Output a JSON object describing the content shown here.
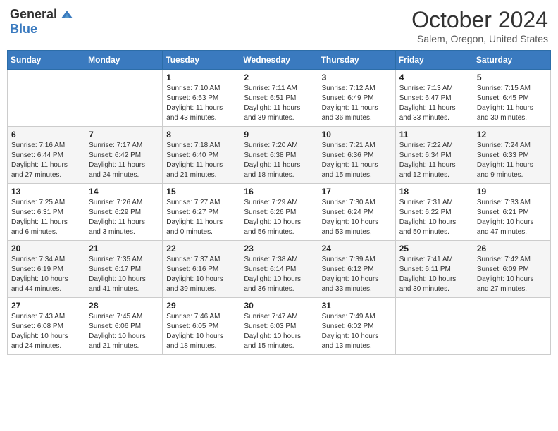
{
  "logo": {
    "general": "General",
    "blue": "Blue"
  },
  "title": "October 2024",
  "location": "Salem, Oregon, United States",
  "days_header": [
    "Sunday",
    "Monday",
    "Tuesday",
    "Wednesday",
    "Thursday",
    "Friday",
    "Saturday"
  ],
  "weeks": [
    [
      {
        "day": "",
        "sunrise": "",
        "sunset": "",
        "daylight": ""
      },
      {
        "day": "",
        "sunrise": "",
        "sunset": "",
        "daylight": ""
      },
      {
        "day": "1",
        "sunrise": "Sunrise: 7:10 AM",
        "sunset": "Sunset: 6:53 PM",
        "daylight": "Daylight: 11 hours and 43 minutes."
      },
      {
        "day": "2",
        "sunrise": "Sunrise: 7:11 AM",
        "sunset": "Sunset: 6:51 PM",
        "daylight": "Daylight: 11 hours and 39 minutes."
      },
      {
        "day": "3",
        "sunrise": "Sunrise: 7:12 AM",
        "sunset": "Sunset: 6:49 PM",
        "daylight": "Daylight: 11 hours and 36 minutes."
      },
      {
        "day": "4",
        "sunrise": "Sunrise: 7:13 AM",
        "sunset": "Sunset: 6:47 PM",
        "daylight": "Daylight: 11 hours and 33 minutes."
      },
      {
        "day": "5",
        "sunrise": "Sunrise: 7:15 AM",
        "sunset": "Sunset: 6:45 PM",
        "daylight": "Daylight: 11 hours and 30 minutes."
      }
    ],
    [
      {
        "day": "6",
        "sunrise": "Sunrise: 7:16 AM",
        "sunset": "Sunset: 6:44 PM",
        "daylight": "Daylight: 11 hours and 27 minutes."
      },
      {
        "day": "7",
        "sunrise": "Sunrise: 7:17 AM",
        "sunset": "Sunset: 6:42 PM",
        "daylight": "Daylight: 11 hours and 24 minutes."
      },
      {
        "day": "8",
        "sunrise": "Sunrise: 7:18 AM",
        "sunset": "Sunset: 6:40 PM",
        "daylight": "Daylight: 11 hours and 21 minutes."
      },
      {
        "day": "9",
        "sunrise": "Sunrise: 7:20 AM",
        "sunset": "Sunset: 6:38 PM",
        "daylight": "Daylight: 11 hours and 18 minutes."
      },
      {
        "day": "10",
        "sunrise": "Sunrise: 7:21 AM",
        "sunset": "Sunset: 6:36 PM",
        "daylight": "Daylight: 11 hours and 15 minutes."
      },
      {
        "day": "11",
        "sunrise": "Sunrise: 7:22 AM",
        "sunset": "Sunset: 6:34 PM",
        "daylight": "Daylight: 11 hours and 12 minutes."
      },
      {
        "day": "12",
        "sunrise": "Sunrise: 7:24 AM",
        "sunset": "Sunset: 6:33 PM",
        "daylight": "Daylight: 11 hours and 9 minutes."
      }
    ],
    [
      {
        "day": "13",
        "sunrise": "Sunrise: 7:25 AM",
        "sunset": "Sunset: 6:31 PM",
        "daylight": "Daylight: 11 hours and 6 minutes."
      },
      {
        "day": "14",
        "sunrise": "Sunrise: 7:26 AM",
        "sunset": "Sunset: 6:29 PM",
        "daylight": "Daylight: 11 hours and 3 minutes."
      },
      {
        "day": "15",
        "sunrise": "Sunrise: 7:27 AM",
        "sunset": "Sunset: 6:27 PM",
        "daylight": "Daylight: 11 hours and 0 minutes."
      },
      {
        "day": "16",
        "sunrise": "Sunrise: 7:29 AM",
        "sunset": "Sunset: 6:26 PM",
        "daylight": "Daylight: 10 hours and 56 minutes."
      },
      {
        "day": "17",
        "sunrise": "Sunrise: 7:30 AM",
        "sunset": "Sunset: 6:24 PM",
        "daylight": "Daylight: 10 hours and 53 minutes."
      },
      {
        "day": "18",
        "sunrise": "Sunrise: 7:31 AM",
        "sunset": "Sunset: 6:22 PM",
        "daylight": "Daylight: 10 hours and 50 minutes."
      },
      {
        "day": "19",
        "sunrise": "Sunrise: 7:33 AM",
        "sunset": "Sunset: 6:21 PM",
        "daylight": "Daylight: 10 hours and 47 minutes."
      }
    ],
    [
      {
        "day": "20",
        "sunrise": "Sunrise: 7:34 AM",
        "sunset": "Sunset: 6:19 PM",
        "daylight": "Daylight: 10 hours and 44 minutes."
      },
      {
        "day": "21",
        "sunrise": "Sunrise: 7:35 AM",
        "sunset": "Sunset: 6:17 PM",
        "daylight": "Daylight: 10 hours and 41 minutes."
      },
      {
        "day": "22",
        "sunrise": "Sunrise: 7:37 AM",
        "sunset": "Sunset: 6:16 PM",
        "daylight": "Daylight: 10 hours and 39 minutes."
      },
      {
        "day": "23",
        "sunrise": "Sunrise: 7:38 AM",
        "sunset": "Sunset: 6:14 PM",
        "daylight": "Daylight: 10 hours and 36 minutes."
      },
      {
        "day": "24",
        "sunrise": "Sunrise: 7:39 AM",
        "sunset": "Sunset: 6:12 PM",
        "daylight": "Daylight: 10 hours and 33 minutes."
      },
      {
        "day": "25",
        "sunrise": "Sunrise: 7:41 AM",
        "sunset": "Sunset: 6:11 PM",
        "daylight": "Daylight: 10 hours and 30 minutes."
      },
      {
        "day": "26",
        "sunrise": "Sunrise: 7:42 AM",
        "sunset": "Sunset: 6:09 PM",
        "daylight": "Daylight: 10 hours and 27 minutes."
      }
    ],
    [
      {
        "day": "27",
        "sunrise": "Sunrise: 7:43 AM",
        "sunset": "Sunset: 6:08 PM",
        "daylight": "Daylight: 10 hours and 24 minutes."
      },
      {
        "day": "28",
        "sunrise": "Sunrise: 7:45 AM",
        "sunset": "Sunset: 6:06 PM",
        "daylight": "Daylight: 10 hours and 21 minutes."
      },
      {
        "day": "29",
        "sunrise": "Sunrise: 7:46 AM",
        "sunset": "Sunset: 6:05 PM",
        "daylight": "Daylight: 10 hours and 18 minutes."
      },
      {
        "day": "30",
        "sunrise": "Sunrise: 7:47 AM",
        "sunset": "Sunset: 6:03 PM",
        "daylight": "Daylight: 10 hours and 15 minutes."
      },
      {
        "day": "31",
        "sunrise": "Sunrise: 7:49 AM",
        "sunset": "Sunset: 6:02 PM",
        "daylight": "Daylight: 10 hours and 13 minutes."
      },
      {
        "day": "",
        "sunrise": "",
        "sunset": "",
        "daylight": ""
      },
      {
        "day": "",
        "sunrise": "",
        "sunset": "",
        "daylight": ""
      }
    ]
  ]
}
